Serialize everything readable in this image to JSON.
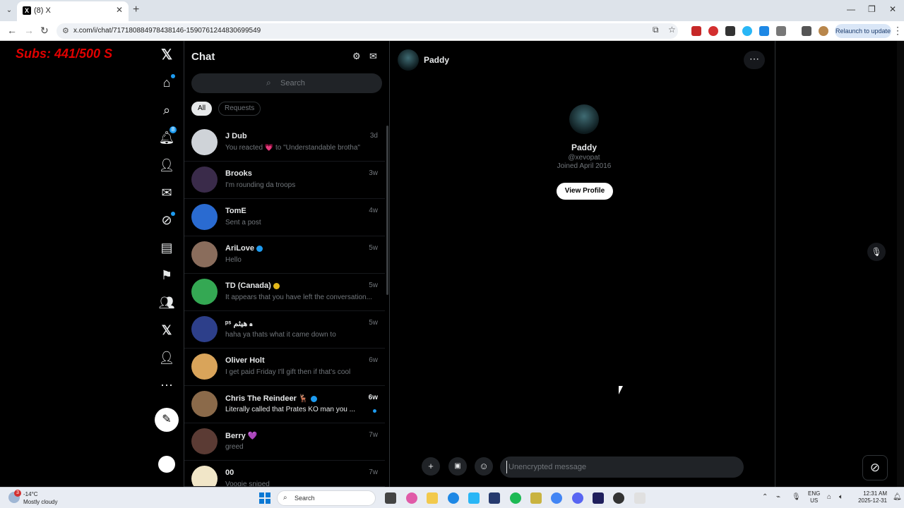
{
  "browser": {
    "tab_title": "(8) X",
    "url": "x.com/i/chat/717180884978438146-1590761244830699549",
    "relaunch_label": "Relaunch to update"
  },
  "overlay": {
    "text": "Subs: 441/500  S"
  },
  "nav": {
    "notifications_badge": "8",
    "post_icon": "post-compose-icon",
    "icons": [
      "x-logo-icon",
      "home-icon",
      "search-icon",
      "bell-icon",
      "follow-icon",
      "mail-icon",
      "grok-icon",
      "lists-icon",
      "bookmark-icon",
      "communities-icon",
      "x-premium-icon",
      "profile-icon",
      "more-icon"
    ]
  },
  "chat": {
    "title": "Chat",
    "search_placeholder": "Search",
    "filters": [
      {
        "label": "All"
      },
      {
        "label": "Requests"
      }
    ],
    "conversations": [
      {
        "name": "J Dub",
        "preview": "You reacted 💗 to \"Understandable brotha\"",
        "time": "3d",
        "avatar_color": "#cfd3d8"
      },
      {
        "name": "Brooks",
        "preview": "I'm rounding da troops",
        "time": "3w",
        "avatar_color": "#3a2b4a"
      },
      {
        "name": "TomE",
        "preview": "Sent a post",
        "time": "4w",
        "avatar_color": "#2a6bd1"
      },
      {
        "name": "AriLove",
        "preview": "Hello",
        "time": "5w",
        "avatar_color": "#8a6d5c"
      },
      {
        "name": "TD (Canada)",
        "preview": "It appears that you have left the conversation...",
        "time": "5w",
        "avatar_color": "#34a853"
      },
      {
        "name": "ᵖˢ هيثم",
        "preview": "haha ya thats what it came down to",
        "time": "5w",
        "avatar_color": "#2d3f8a"
      },
      {
        "name": "Oliver Holt",
        "preview": "I get paid Friday I'll gift then if that's cool",
        "time": "6w",
        "avatar_color": "#d9a45a"
      },
      {
        "name": "Chris The Reindeer 🦌",
        "preview": "Literally called that Prates KO man you ...",
        "time": "6w",
        "avatar_color": "#8b6a4a"
      },
      {
        "name": "Berry 💜",
        "preview": "greed",
        "time": "7w",
        "avatar_color": "#5b3b34"
      },
      {
        "name": "00",
        "preview": "Voogie sniped",
        "time": "7w",
        "avatar_color": "#f1e6c8"
      }
    ]
  },
  "conversation": {
    "name": "Paddy",
    "handle": "@xevopat",
    "joined": "Joined April 2016",
    "view_profile_label": "View Profile",
    "composer_placeholder": "Unencrypted message"
  },
  "taskbar": {
    "weather_badge": "3",
    "temp": "-14°C",
    "weather": "Mostly cloudy",
    "search": "Search",
    "lang_line1": "ENG",
    "lang_line2": "US",
    "time": "12:31 AM",
    "date": "2025-12-31"
  }
}
